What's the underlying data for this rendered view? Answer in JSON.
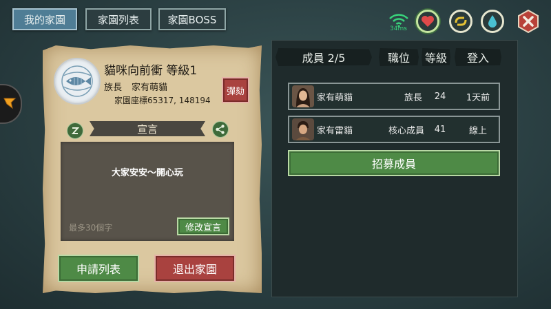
{
  "tabs": [
    {
      "label": "我的家園",
      "active": true
    },
    {
      "label": "家園列表",
      "active": false
    },
    {
      "label": "家園BOSS",
      "active": false
    }
  ],
  "status": {
    "ping": "34ms"
  },
  "top_icons": [
    "wifi-icon",
    "heart-icon",
    "exchange-icon",
    "drop-icon",
    "close-icon"
  ],
  "home": {
    "name_level": "貓咪向前衝 等級1",
    "leader_label": "族長",
    "leader_name": "家有萌貓",
    "coords": "家園座標65317, 148194",
    "impeach_label": "彈劾"
  },
  "declaration": {
    "title": "宣言",
    "text": "大家安安～開心玩",
    "limit_hint": "最多30個字",
    "edit_label": "修改宣言"
  },
  "buttons": {
    "apply_list": "申請列表",
    "leave_home": "退出家園",
    "recruit": "招募成員"
  },
  "members_header": {
    "members": "成員 2/5",
    "position": "職位",
    "level": "等級",
    "login": "登入"
  },
  "members": [
    {
      "name": "家有萌貓",
      "position": "族長",
      "level": "24",
      "login": "1天前"
    },
    {
      "name": "家有雷貓",
      "position": "核心成員",
      "level": "41",
      "login": "線上"
    }
  ],
  "colors": {
    "green_button": "#4e8a46",
    "red_button": "#a9423f",
    "active_tab": "#4f7d95",
    "parchment": "#dbc8a0"
  }
}
